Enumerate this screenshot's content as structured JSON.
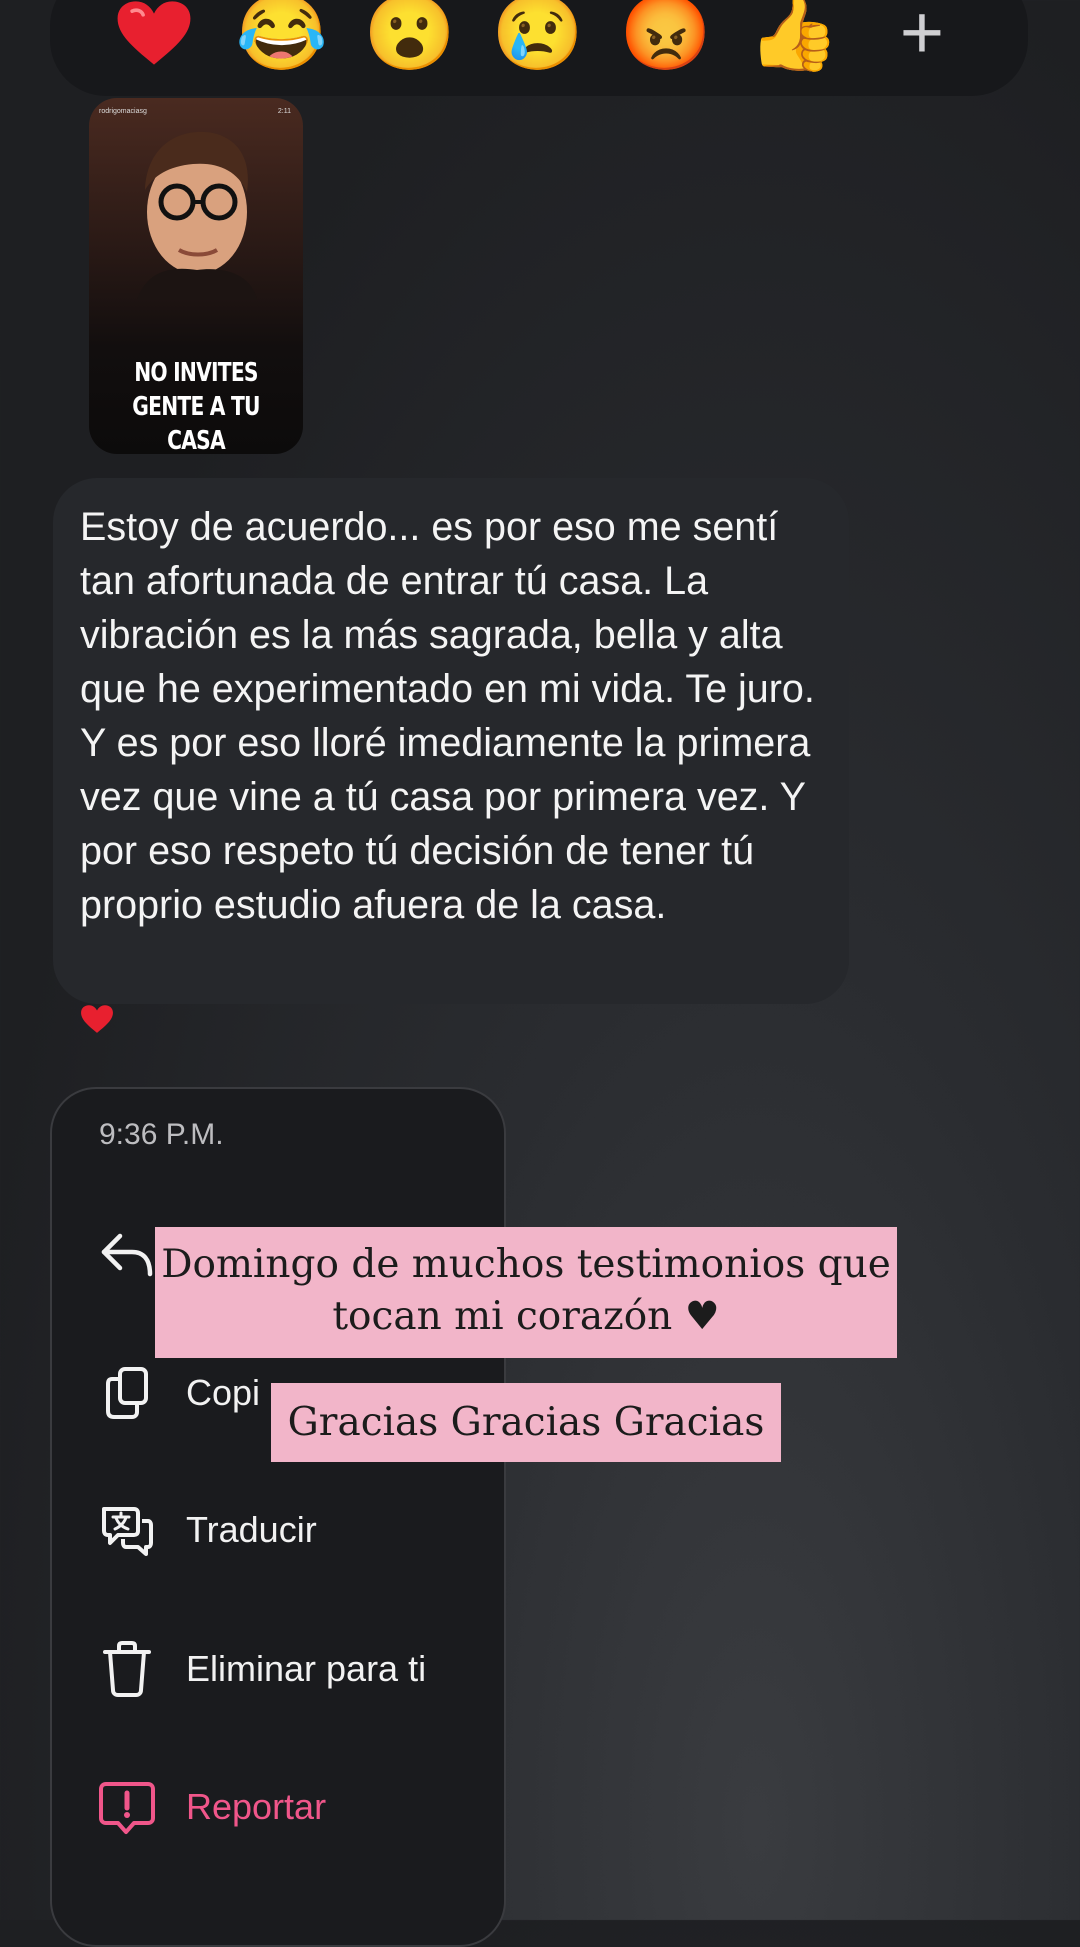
{
  "reactions": [
    {
      "name": "heart",
      "glyph": "❤️"
    },
    {
      "name": "laughing",
      "glyph": "😂"
    },
    {
      "name": "surprised",
      "glyph": "😮"
    },
    {
      "name": "crying",
      "glyph": "😢"
    },
    {
      "name": "angry",
      "glyph": "😡"
    },
    {
      "name": "thumbs-up",
      "glyph": "👍"
    },
    {
      "name": "add",
      "glyph": "+"
    }
  ],
  "shared_reel": {
    "username": "rodrigomaciasg",
    "duration": "2:11",
    "caption_line1": "NO INVITES",
    "caption_line2": "GENTE A TU CASA"
  },
  "message": {
    "text": "Estoy de acuerdo... es por eso me sentí tan afortunada de entrar tú casa. La vibración es la más sagrada, bella y alta que he experimentado en mi vida. Te juro. Y es por eso lloré imediamente la primera vez que vine a tú casa por primera vez. Y por eso respeto tú decisión de tener tú proprio estudio afuera de la casa.",
    "reaction": "❤️"
  },
  "menu": {
    "time": "9:36 P.M.",
    "items": [
      {
        "id": "reply",
        "label": "",
        "icon": "reply-icon"
      },
      {
        "id": "copy",
        "label": "Copi",
        "icon": "copy-icon"
      },
      {
        "id": "translate",
        "label": "Traducir",
        "icon": "translate-icon"
      },
      {
        "id": "delete",
        "label": "Eliminar para ti",
        "icon": "trash-icon"
      },
      {
        "id": "report",
        "label": "Reportar",
        "icon": "report-icon"
      }
    ]
  },
  "overlay_captions": {
    "line1": "Domingo de muchos testimonios que",
    "line2": "tocan mi corazón ♥",
    "second": "Gracias Gracias Gracias"
  },
  "colors": {
    "report_accent": "#f0568a",
    "overlay_bg": "#f2b5c9",
    "heart": "#e8202f"
  }
}
